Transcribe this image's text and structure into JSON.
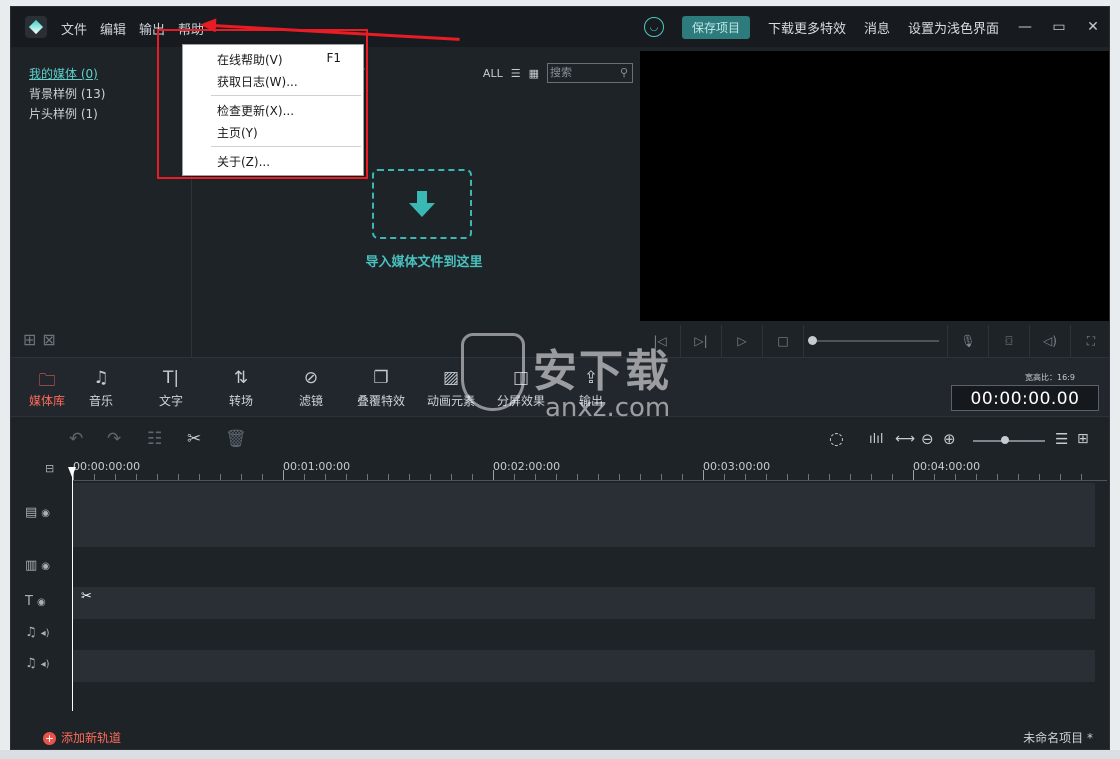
{
  "menubar": {
    "items": [
      "文件",
      "编辑",
      "输出",
      "帮助"
    ]
  },
  "header": {
    "save_button": "保存项目",
    "download_effects": "下载更多特效",
    "messages": "消息",
    "light_theme": "设置为浅色界面"
  },
  "media_list": {
    "items": [
      "我的媒体 (0)",
      "背景样例 (13)",
      "片头样例 (1)"
    ]
  },
  "library": {
    "filter_all": "ALL",
    "search_placeholder": "搜索",
    "import_text": "导入媒体文件到这里"
  },
  "tabs": [
    {
      "label": "媒体库",
      "icon": "folder-icon",
      "active": true
    },
    {
      "label": "音乐",
      "icon": "music-note-icon"
    },
    {
      "label": "文字",
      "icon": "text-icon"
    },
    {
      "label": "转场",
      "icon": "transition-icon"
    },
    {
      "label": "滤镜",
      "icon": "filter-icon"
    },
    {
      "label": "叠覆特效",
      "icon": "overlay-icon"
    },
    {
      "label": "动画元素",
      "icon": "image-icon"
    },
    {
      "label": "分屏效果",
      "icon": "split-screen-icon"
    },
    {
      "label": "输出",
      "icon": "export-icon"
    }
  ],
  "preview": {
    "ratio_label": "宽高比：",
    "ratio_value": "16:9",
    "timecode": "00:00:00.00"
  },
  "timeline": {
    "ruler": [
      "00:00:00:00",
      "00:01:00:00",
      "00:02:00:00",
      "00:03:00:00",
      "00:04:00:00"
    ]
  },
  "help_menu": {
    "items": [
      {
        "label": "在线帮助(V)",
        "shortcut": "F1"
      },
      {
        "label": "获取日志(W)..."
      },
      {
        "label": "检查更新(X)..."
      },
      {
        "label": "主页(Y)"
      },
      {
        "label": "关于(Z)..."
      }
    ]
  },
  "footer": {
    "add_track": "添加新轨道",
    "project_name": "未命名项目 *"
  },
  "watermark": {
    "text": "安下载",
    "sub": "anxz.com"
  },
  "colors": {
    "accent": "#4fc7c0",
    "active_tab": "#ff6b5b",
    "annotation": "#e81c24"
  }
}
